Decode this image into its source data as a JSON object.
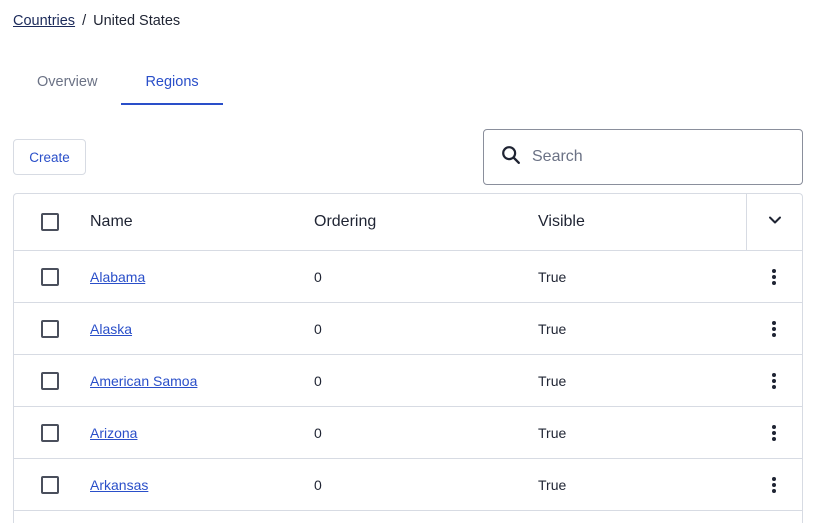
{
  "breadcrumb": {
    "parent": "Countries",
    "separator": "/",
    "current": "United States"
  },
  "tabs": [
    {
      "label": "Overview",
      "active": false
    },
    {
      "label": "Regions",
      "active": true
    }
  ],
  "toolbar": {
    "create_label": "Create",
    "search_placeholder": "Search",
    "search_value": ""
  },
  "table": {
    "columns": {
      "name": "Name",
      "ordering": "Ordering",
      "visible": "Visible"
    },
    "rows": [
      {
        "name": "Alabama",
        "ordering": "0",
        "visible": "True"
      },
      {
        "name": "Alaska",
        "ordering": "0",
        "visible": "True"
      },
      {
        "name": "American Samoa",
        "ordering": "0",
        "visible": "True"
      },
      {
        "name": "Arizona",
        "ordering": "0",
        "visible": "True"
      },
      {
        "name": "Arkansas",
        "ordering": "0",
        "visible": "True"
      }
    ]
  },
  "colors": {
    "accent": "#2a4fc9",
    "border": "#d7dbe3",
    "text": "#1f2433"
  }
}
